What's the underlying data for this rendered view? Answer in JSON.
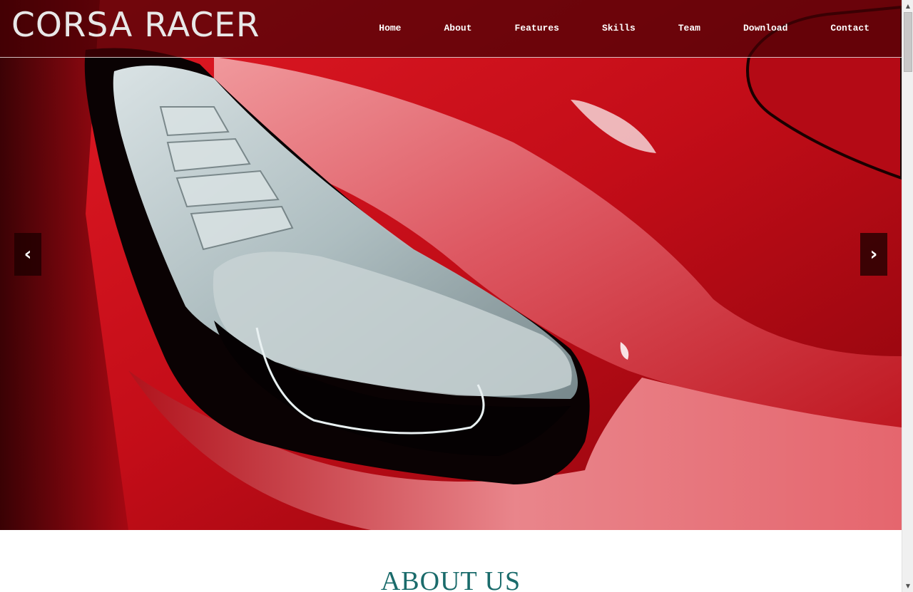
{
  "header": {
    "brand": "CORSA RACER",
    "nav": [
      "Home",
      "About",
      "Features",
      "Skills",
      "Team",
      "Download",
      "Contact"
    ]
  },
  "carousel": {
    "prev_icon": "chevron-left-icon",
    "next_icon": "chevron-right-icon",
    "prev_glyph": "‹",
    "next_glyph": "›",
    "image": "red sports car headlight"
  },
  "about": {
    "title": "ABOUT US"
  },
  "scrollbar": {
    "up_glyph": "▲",
    "down_glyph": "▼"
  },
  "colors": {
    "header_bg": "#460004",
    "car_red": "#c4101b",
    "about_title": "#1a6b6b"
  }
}
